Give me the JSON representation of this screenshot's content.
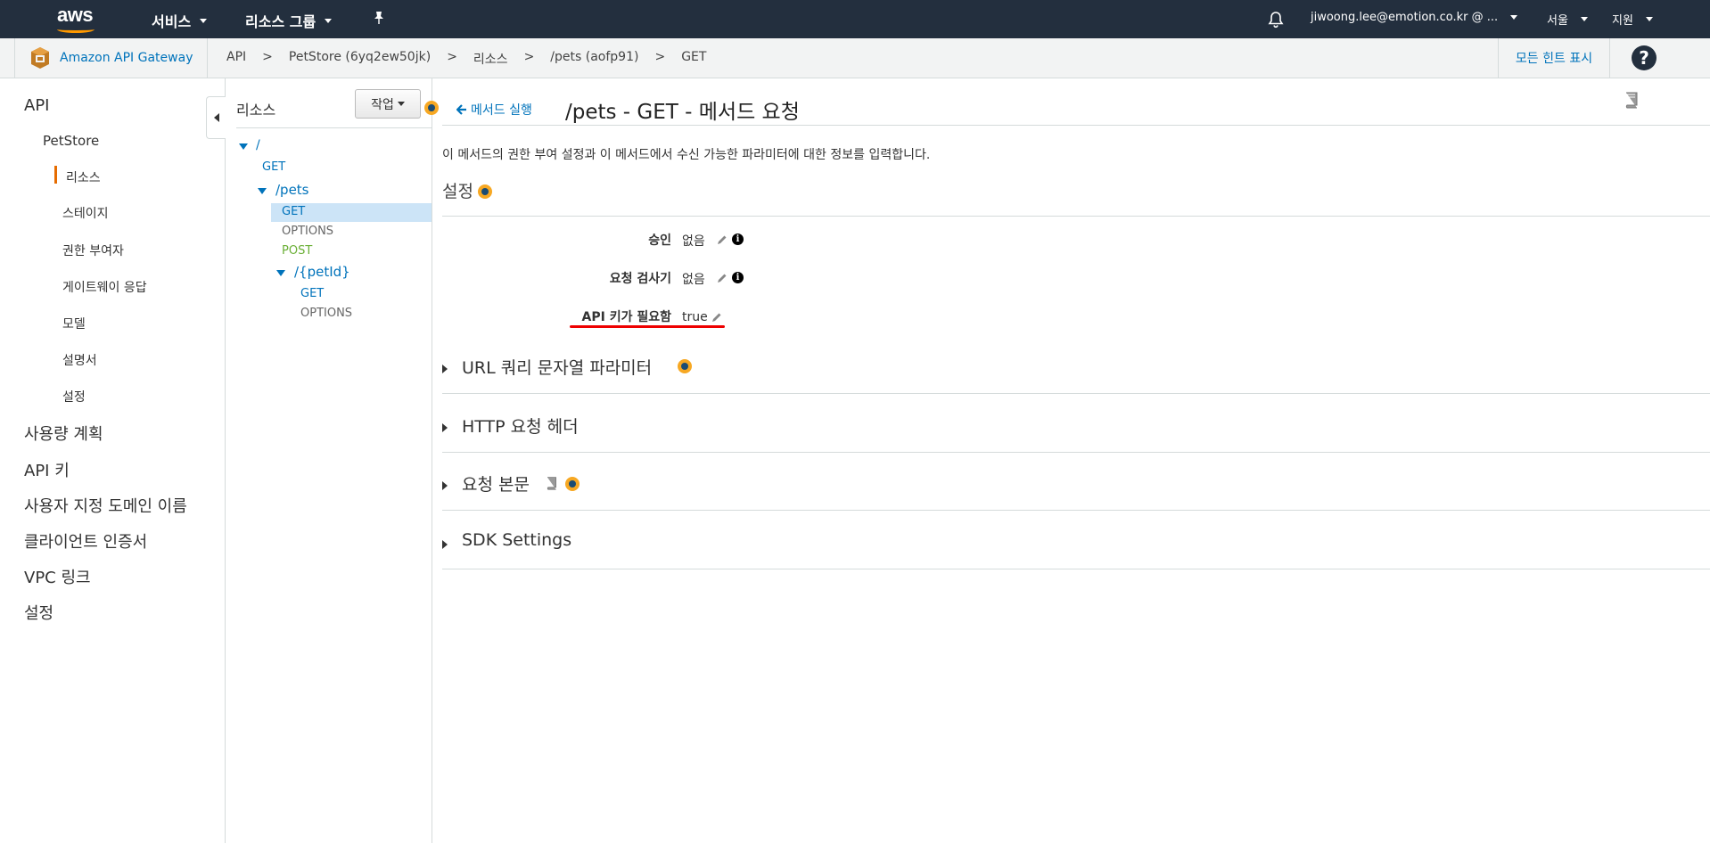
{
  "topnav": {
    "logo_text": "aws",
    "services_label": "서비스",
    "resource_groups_label": "리소스 그룹",
    "account_label": "jiwoong.lee@emotion.co.kr @ ...",
    "region_label": "서울",
    "support_label": "지원"
  },
  "breadcrumb": {
    "service_name": "Amazon API Gateway",
    "items": [
      "API",
      ">",
      "PetStore (6yq2ew50jk)",
      ">",
      "리소스",
      ">",
      "/pets (aofp91)",
      ">",
      "GET"
    ],
    "hints_label": "모든 힌트 표시",
    "help_label": "?"
  },
  "leftnav": {
    "api": "API",
    "petstore": "PetStore",
    "resources": "리소스",
    "stages": "스테이지",
    "authorizers": "권한 부여자",
    "gateway_responses": "게이트웨이 응답",
    "models": "모델",
    "documentation": "설명서",
    "settings": "설정",
    "usage_plans": "사용량 계획",
    "api_keys": "API 키",
    "custom_domains": "사용자 지정 도메인 이름",
    "client_certs": "클라이언트 인증서",
    "vpc_links": "VPC 링크",
    "global_settings": "설정"
  },
  "resources_panel": {
    "title": "리소스",
    "actions_label": "작업",
    "tree": {
      "root": "/",
      "root_get": "GET",
      "pets": "/pets",
      "pets_get": "GET",
      "pets_options": "OPTIONS",
      "pets_post": "POST",
      "petid": "/{petId}",
      "petid_get": "GET",
      "petid_options": "OPTIONS"
    }
  },
  "main": {
    "back_label": "메서드 실행",
    "title": "/pets - GET - 메서드 요청",
    "description": "이 메서드의 권한 부여 설정과 이 메서드에서 수신 가능한 파라미터에 대한 정보를 입력합니다.",
    "settings_heading": "설정",
    "fields": [
      {
        "label": "승인",
        "value": "없음"
      },
      {
        "label": "요청 검사기",
        "value": "없음"
      },
      {
        "label": "API 키가 필요함",
        "value": "true"
      }
    ],
    "sections": [
      "URL 쿼리 문자열 파라미터",
      "HTTP 요청 헤더",
      "요청 본문",
      "SDK Settings"
    ]
  },
  "colors": {
    "nav_bg": "#232f3e",
    "link": "#0073bb",
    "accent_orange": "#ff9900",
    "post_green": "#6aaf35",
    "selected_bg": "#cce4f7",
    "highlight_red": "#ee0000"
  }
}
